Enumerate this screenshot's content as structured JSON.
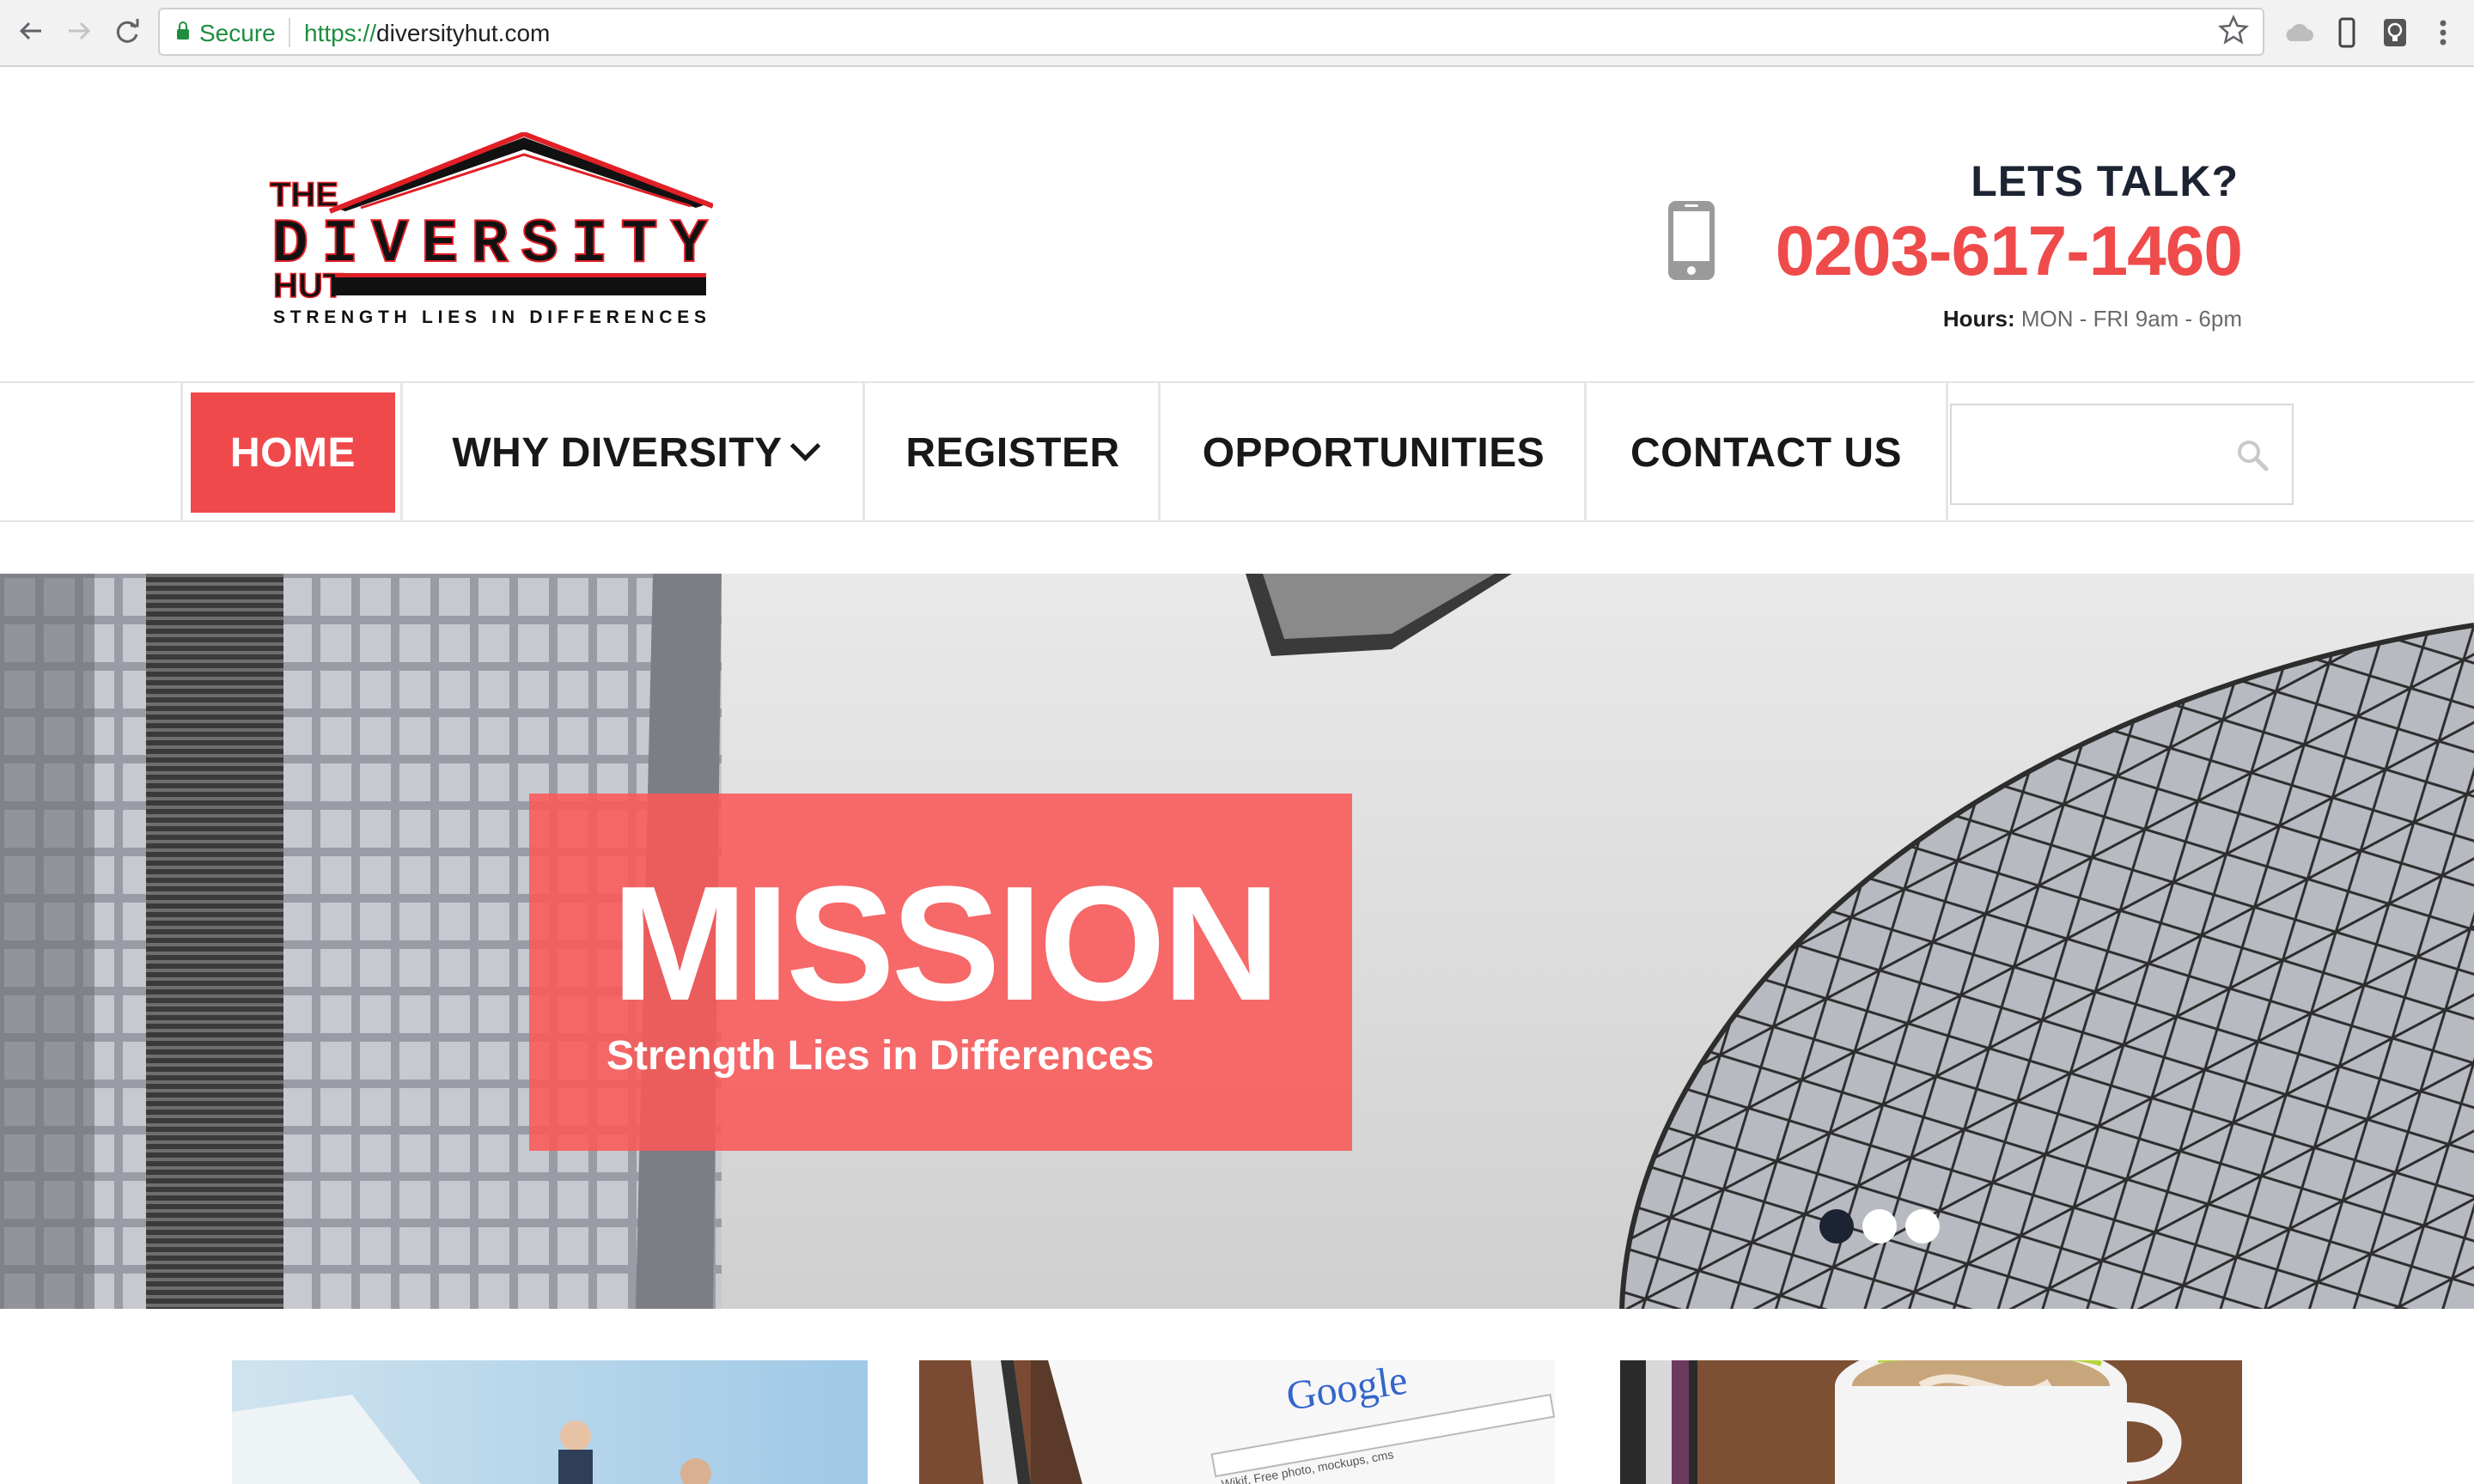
{
  "browser": {
    "secure_label": "Secure",
    "url_scheme": "https://",
    "url_host": "diversityhut.com"
  },
  "logo": {
    "text_the": "THE",
    "text_main": "DIVERSITY",
    "text_hut": "HUT",
    "tagline": "STRENGTH LIES IN DIFFERENCES"
  },
  "contact": {
    "title": "LETS TALK?",
    "phone": "0203-617-1460",
    "hours_label": "Hours:",
    "hours_value": "MON - FRI 9am - 6pm",
    "icon": "phone-icon"
  },
  "menu": {
    "items": [
      {
        "label": "HOME",
        "active": true
      },
      {
        "label": "WHY DIVERSITY",
        "dropdown": true
      },
      {
        "label": "REGISTER"
      },
      {
        "label": "OPPORTUNITIES"
      },
      {
        "label": "CONTACT US"
      }
    ],
    "search_placeholder": ""
  },
  "hero": {
    "title": "MISSION",
    "subtitle": "Strength Lies in Differences",
    "slides_total": 3,
    "slide_active": 1
  },
  "thumbnails": {
    "google_text": "Google",
    "google_search_text": "Wikif, Free photo, mockups, cms"
  },
  "colors": {
    "accent": "#f0494b",
    "logo_red": "#e11f26",
    "dark_text": "#1c2332"
  }
}
